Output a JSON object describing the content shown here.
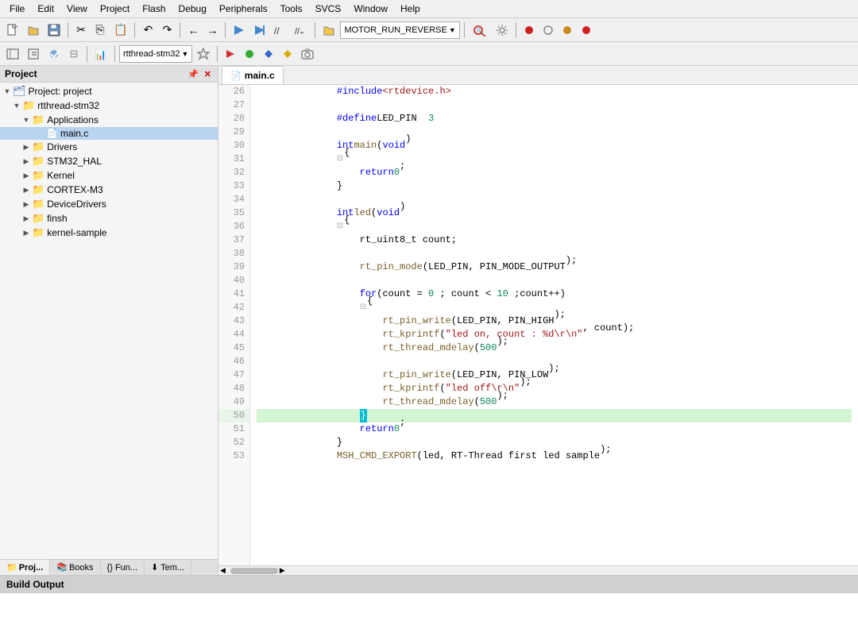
{
  "menubar": {
    "items": [
      "File",
      "Edit",
      "View",
      "Project",
      "Flash",
      "Debug",
      "Peripherals",
      "Tools",
      "SVCS",
      "Window",
      "Help"
    ]
  },
  "toolbar1": {
    "dropdown_target": "MOTOR_RUN_REVERSE"
  },
  "toolbar2": {
    "dropdown_target": "rtthread-stm32"
  },
  "project_panel": {
    "title": "Project",
    "root": "Project: project",
    "tree": [
      {
        "id": "project-root",
        "label": "Project: project",
        "indent": 0,
        "type": "root",
        "expanded": true,
        "icon": "▼"
      },
      {
        "id": "rtthread-stm32",
        "label": "rtthread-stm32",
        "indent": 1,
        "type": "folder",
        "expanded": true,
        "icon": "▼"
      },
      {
        "id": "applications",
        "label": "Applications",
        "indent": 2,
        "type": "folder",
        "expanded": true,
        "icon": "▼"
      },
      {
        "id": "main-c",
        "label": "main.c",
        "indent": 3,
        "type": "file",
        "icon": "📄"
      },
      {
        "id": "drivers",
        "label": "Drivers",
        "indent": 2,
        "type": "folder",
        "expanded": false,
        "icon": "▶"
      },
      {
        "id": "stm32-hal",
        "label": "STM32_HAL",
        "indent": 2,
        "type": "folder",
        "expanded": false,
        "icon": "▶"
      },
      {
        "id": "kernel",
        "label": "Kernel",
        "indent": 2,
        "type": "folder",
        "expanded": false,
        "icon": "▶"
      },
      {
        "id": "cortex-m3",
        "label": "CORTEX-M3",
        "indent": 2,
        "type": "folder",
        "expanded": false,
        "icon": "▶"
      },
      {
        "id": "devicedrivers",
        "label": "DeviceDrivers",
        "indent": 2,
        "type": "folder",
        "expanded": false,
        "icon": "▶"
      },
      {
        "id": "finsh",
        "label": "finsh",
        "indent": 2,
        "type": "folder",
        "expanded": false,
        "icon": "▶"
      },
      {
        "id": "kernel-sample",
        "label": "kernel-sample",
        "indent": 2,
        "type": "folder",
        "expanded": false,
        "icon": "▶"
      }
    ],
    "tabs": [
      {
        "id": "proj-tab",
        "label": "Proj...",
        "icon": "📁",
        "active": true
      },
      {
        "id": "books-tab",
        "label": "Books",
        "icon": "📚",
        "active": false
      },
      {
        "id": "fun-tab",
        "label": "{} Fun...",
        "icon": "{}",
        "active": false
      },
      {
        "id": "tem-tab",
        "label": "⬇ Tem...",
        "icon": "⬇",
        "active": false
      }
    ]
  },
  "editor": {
    "tab": "main.c",
    "lines": [
      {
        "num": 26,
        "content": "    #include <rtdevice.h>",
        "type": "include",
        "highlighted": false,
        "active": false
      },
      {
        "num": 27,
        "content": "",
        "type": "blank",
        "highlighted": false,
        "active": false
      },
      {
        "num": 28,
        "content": "    #define LED_PIN  3",
        "type": "define",
        "highlighted": false,
        "active": false
      },
      {
        "num": 29,
        "content": "",
        "type": "blank",
        "highlighted": false,
        "active": false
      },
      {
        "num": 30,
        "content": "    int main(void)",
        "type": "code",
        "highlighted": false,
        "active": false
      },
      {
        "num": 31,
        "content": "    {",
        "type": "code",
        "highlighted": false,
        "active": false,
        "fold": true
      },
      {
        "num": 32,
        "content": "        return 0;",
        "type": "code",
        "highlighted": false,
        "active": false
      },
      {
        "num": 33,
        "content": "    }",
        "type": "code",
        "highlighted": false,
        "active": false
      },
      {
        "num": 34,
        "content": "",
        "type": "blank",
        "highlighted": false,
        "active": false
      },
      {
        "num": 35,
        "content": "    int led(void)",
        "type": "code",
        "highlighted": false,
        "active": false
      },
      {
        "num": 36,
        "content": "    {",
        "type": "code",
        "highlighted": false,
        "active": false,
        "fold": true
      },
      {
        "num": 37,
        "content": "        rt_uint8_t count;",
        "type": "code",
        "highlighted": false,
        "active": false
      },
      {
        "num": 38,
        "content": "",
        "type": "blank",
        "highlighted": false,
        "active": false
      },
      {
        "num": 39,
        "content": "        rt_pin_mode(LED_PIN, PIN_MODE_OUTPUT);",
        "type": "code",
        "highlighted": false,
        "active": false
      },
      {
        "num": 40,
        "content": "",
        "type": "blank",
        "highlighted": false,
        "active": false
      },
      {
        "num": 41,
        "content": "        for(count = 0 ; count < 10 ;count++)",
        "type": "code",
        "highlighted": false,
        "active": false
      },
      {
        "num": 42,
        "content": "        {",
        "type": "code",
        "highlighted": false,
        "active": false,
        "fold": true
      },
      {
        "num": 43,
        "content": "            rt_pin_write(LED_PIN, PIN_HIGH);",
        "type": "code",
        "highlighted": false,
        "active": false
      },
      {
        "num": 44,
        "content": "            rt_kprintf(\"led on, count : %d\\r\\n\", count);",
        "type": "code",
        "highlighted": false,
        "active": false
      },
      {
        "num": 45,
        "content": "            rt_thread_mdelay(500);",
        "type": "code",
        "highlighted": false,
        "active": false
      },
      {
        "num": 46,
        "content": "",
        "type": "blank",
        "highlighted": false,
        "active": false
      },
      {
        "num": 47,
        "content": "            rt_pin_write(LED_PIN, PIN_LOW);",
        "type": "code",
        "highlighted": false,
        "active": false
      },
      {
        "num": 48,
        "content": "            rt_kprintf(\"led off\\r\\n\");",
        "type": "code",
        "highlighted": false,
        "active": false
      },
      {
        "num": 49,
        "content": "            rt_thread_mdelay(500);",
        "type": "code",
        "highlighted": false,
        "active": false
      },
      {
        "num": 50,
        "content": "        }",
        "type": "code",
        "highlighted": true,
        "active": true
      },
      {
        "num": 51,
        "content": "        return 0;",
        "type": "code",
        "highlighted": false,
        "active": false
      },
      {
        "num": 52,
        "content": "    }",
        "type": "code",
        "highlighted": false,
        "active": false
      },
      {
        "num": 53,
        "content": "    MSH_CMD_EXPORT(led, RT-Thread first led sample);",
        "type": "code",
        "highlighted": false,
        "active": false
      }
    ]
  },
  "build_output": {
    "title": "Build Output"
  },
  "icons": {
    "new": "📄",
    "open": "📂",
    "save": "💾",
    "cut": "✂",
    "copy": "📋",
    "paste": "📌",
    "undo": "↶",
    "redo": "↷",
    "back": "←",
    "forward": "→",
    "build": "🔨",
    "debug": "▶",
    "pin": "📌",
    "close": "✕"
  }
}
